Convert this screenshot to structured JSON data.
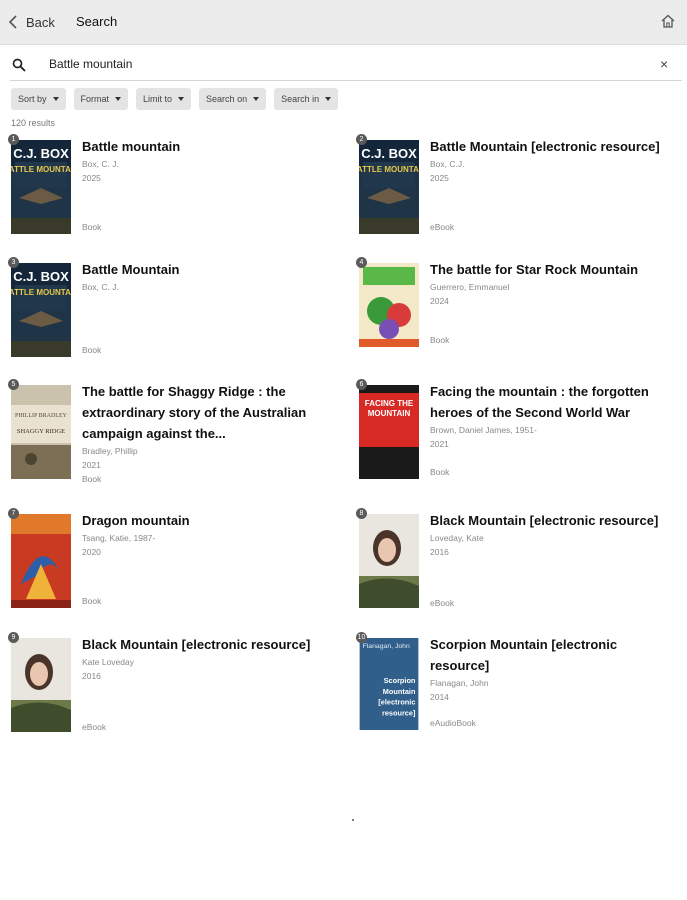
{
  "header": {
    "back_label": "Back",
    "title": "Search"
  },
  "search": {
    "value": "Battle mountain",
    "clear": "×"
  },
  "filters": [
    "Sort by",
    "Format",
    "Limit to",
    "Search on",
    "Search in"
  ],
  "results_count": "120 results",
  "results": [
    {
      "num": "1",
      "title": "Battle mountain",
      "author": "Box, C. J.",
      "year": "2025",
      "format": "Book",
      "cover_top": "C.J. BOX",
      "cover_sub": "BATTLE MOUNTAIN"
    },
    {
      "num": "2",
      "title": "Battle Mountain [electronic resource]",
      "author": "Box, C.J.",
      "year": "2025",
      "format": "eBook",
      "cover_top": "C.J. BOX",
      "cover_sub": "BATTLE MOUNTAIN"
    },
    {
      "num": "3",
      "title": "Battle Mountain",
      "author": "Box, C. J.",
      "year": "",
      "format": "Book",
      "cover_top": "C.J. BOX",
      "cover_sub": "BATTLE MOUNTAIN"
    },
    {
      "num": "4",
      "title": "The battle for Star Rock Mountain",
      "author": "Guerrero, Emmanuel",
      "year": "2024",
      "format": "Book",
      "cover_top": "",
      "cover_sub": ""
    },
    {
      "num": "5",
      "title": "The battle for Shaggy Ridge : the extraordinary story of the Australian campaign against the...",
      "author": "Bradley, Phillip",
      "year": "2021",
      "format": "Book",
      "cover_top": "PHILLIP BRADLEY",
      "cover_sub": "SHAGGY RIDGE"
    },
    {
      "num": "6",
      "title": "Facing the mountain : the forgotten heroes of the Second World War",
      "author": "Brown, Daniel James, 1951-",
      "year": "2021",
      "format": "Book",
      "cover_top": "FACING THE MOUNTAIN",
      "cover_sub": ""
    },
    {
      "num": "7",
      "title": "Dragon mountain",
      "author": "Tsang, Katie, 1987-",
      "year": "2020",
      "format": "Book",
      "cover_top": "",
      "cover_sub": ""
    },
    {
      "num": "8",
      "title": "Black Mountain [electronic resource]",
      "author": "Loveday, Kate",
      "year": "2016",
      "format": "eBook",
      "cover_top": "",
      "cover_sub": ""
    },
    {
      "num": "9",
      "title": "Black Mountain [electronic resource]",
      "author": "Kate Loveday",
      "year": "2016",
      "format": "eBook",
      "cover_top": "",
      "cover_sub": ""
    },
    {
      "num": "10",
      "title": "Scorpion Mountain [electronic resource]",
      "author": "Flanagan, John",
      "year": "2014",
      "format": "eAudioBook",
      "cover_top": "Flanagan, John",
      "cover_sub": "Scorpion Mountain [electronic resource]"
    }
  ]
}
